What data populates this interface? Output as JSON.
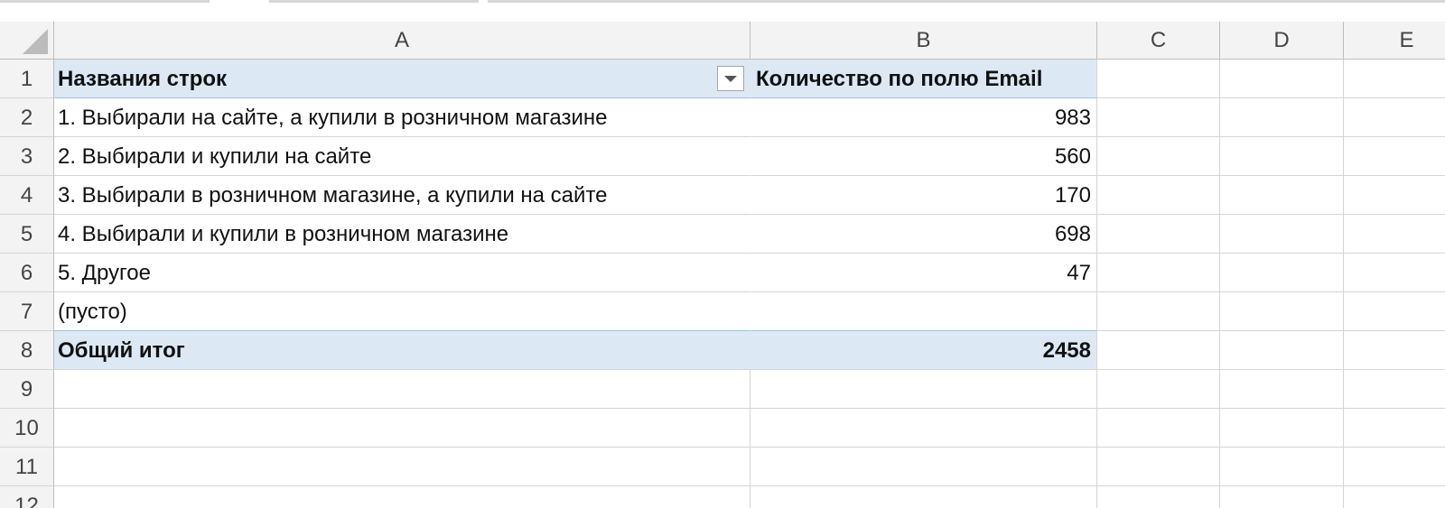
{
  "columns": [
    "A",
    "B",
    "C",
    "D",
    "E"
  ],
  "rows": [
    "1",
    "2",
    "3",
    "4",
    "5",
    "6",
    "7",
    "8",
    "9",
    "10",
    "11",
    "12"
  ],
  "pivot": {
    "header_label": "Названия строк",
    "header_value": "Количество по полю Email",
    "items": [
      {
        "label": "1. Выбирали на сайте, а купили в розничном магазине",
        "value": "983"
      },
      {
        "label": "2. Выбирали и купили на сайте",
        "value": "560"
      },
      {
        "label": "3. Выбирали в розничном магазине, а купили на сайте",
        "value": "170"
      },
      {
        "label": "4. Выбирали и купили в розничном магазине",
        "value": "698"
      },
      {
        "label": "5. Другое",
        "value": "47"
      },
      {
        "label": "(пусто)",
        "value": ""
      }
    ],
    "total_label": "Общий итог",
    "total_value": "2458"
  },
  "colors": {
    "pivot_header_fill": "#dce9f5",
    "grid_line": "#d4d4d4",
    "header_bg": "#f3f3f3"
  }
}
